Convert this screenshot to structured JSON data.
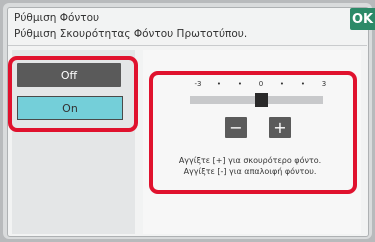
{
  "header": {
    "title": "Ρύθμιση Φόντου",
    "subtitle": "Ρύθμιση Σκουρότητας Φόντου Πρωτοτύπου.",
    "ok_label": "OK"
  },
  "toggle": {
    "off_label": "Off",
    "on_label": "On",
    "selected": "On"
  },
  "slider": {
    "tick_labels": [
      "-3",
      "•",
      "•",
      "0",
      "•",
      "•",
      "3"
    ],
    "min": -3,
    "max": 3,
    "value": 0,
    "minus_label": "−",
    "plus_label": "+"
  },
  "hints": {
    "line1": "Αγγίξτε [+] για σκουρότερο φόντο.",
    "line2": "Αγγίξτε [-] για απαλοιφή φόντου."
  },
  "colors": {
    "accent_ok": "#2c8a68",
    "highlight": "#e0122e",
    "selected_button": "#74cfd9"
  }
}
